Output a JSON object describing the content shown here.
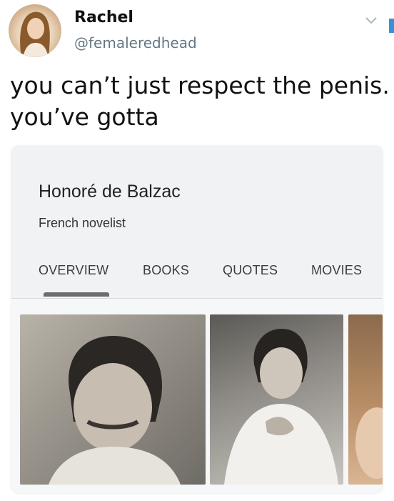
{
  "tweet": {
    "display_name": "Rachel",
    "handle": "@femaleredhead",
    "text_lines": [
      "you can’t just respect the penis.",
      "you’ve gotta"
    ]
  },
  "card": {
    "entity_name": "Honoré de Balzac",
    "entity_description": "French novelist",
    "tabs": [
      {
        "label": "OVERVIEW",
        "selected": true
      },
      {
        "label": "BOOKS",
        "selected": false
      },
      {
        "label": "QUOTES",
        "selected": false
      },
      {
        "label": "MOVIES",
        "selected": false
      }
    ],
    "images": [
      {
        "subject": "portrait photograph of Balzac (close-up)"
      },
      {
        "subject": "portrait photograph of Balzac (hand on chest)"
      },
      {
        "subject": "partially visible painting"
      }
    ]
  },
  "colors": {
    "text_primary": "#111111",
    "handle_gray": "#657786",
    "card_background": "#f1f2f3",
    "tab_indicator": "#6a6d70",
    "edge_blue": "#3a8fd9"
  },
  "icons": {
    "caret": "chevron-down-icon"
  }
}
